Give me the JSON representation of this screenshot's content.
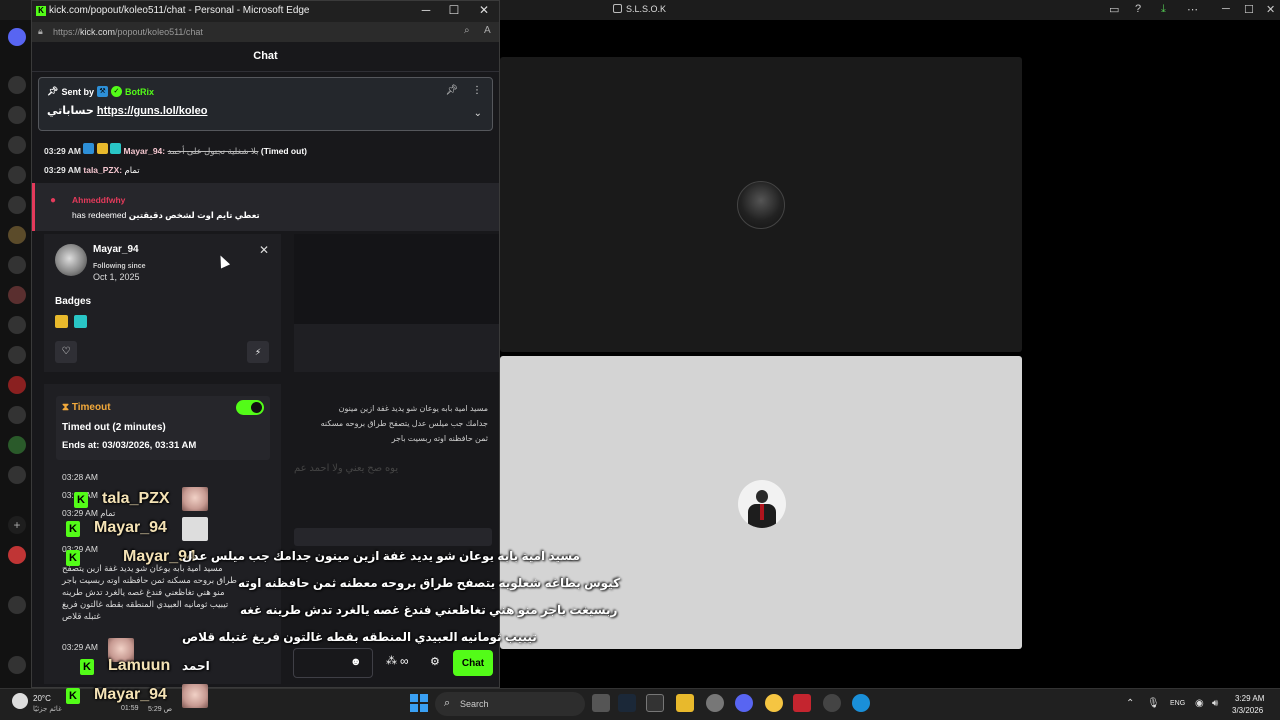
{
  "background_app": {
    "title": "S.L.S.O.K"
  },
  "edge": {
    "title": "kick.com/popout/koleo511/chat - Personal - Microsoft Edge",
    "url_prefix": "https://",
    "url_host": "kick.com",
    "url_path": "/popout/koleo511/chat",
    "minimize": "─",
    "maximize": "☐",
    "close": "✕"
  },
  "chat": {
    "header": "Chat",
    "pinned": {
      "sent_by": "Sent by",
      "sender": "BotRix",
      "text_prefix": "حساباتي",
      "link": "https://guns.lol/koleo"
    },
    "messages": [
      {
        "time": "03:29 AM",
        "user": "Mayar_94:",
        "text": "بلا شغلية نجنول على أحمد",
        "suffix": "(Timed out)"
      },
      {
        "time": "03:29 AM",
        "user": "tala_PZX:",
        "text": "تمام"
      }
    ],
    "redeem": {
      "user": "Ahmeddfwhy",
      "text_prefix": "has redeemed",
      "reward": "تعطي تايم اوت لشخص دقيقتين"
    },
    "side_arabic": "مسيد امية بابه يوعان شو يديد غفة ازين مينون جدامك جب ميلس عدل يتصفح طراق بروحه مسكنه ثمن حافظنه اوته ربسيت باجر",
    "faded": "يوه صح يعني ولا احمد عم",
    "send_label": "Chat"
  },
  "profile": {
    "name": "Mayar_94",
    "following_label": "Following since",
    "following_date": "Oct 1, 2025",
    "badges_label": "Badges"
  },
  "timeout": {
    "label": "Timeout",
    "title": "Timed out (2 minutes)",
    "ends": "Ends at: 03/03/2026, 03:31 AM",
    "history": [
      "03:28 AM",
      "03:29 AM",
      "03:29 AM تمام",
      "03:29 AM",
      "03:29 AM",
      "03:29 AM"
    ],
    "history_text": "مسيد امية بابه يوعان شو يديد غفة ازين يتصفح طراق بروحه مسكنه ثمن حافظنه اوته ربسيت باجر منو هني تغاظعني فندغ غصه يالغرد تدش طرينه تيبيب ثومانيه العبيدي المنطقه بقطه غالتون فريغ غتبله قلاص"
  },
  "overlay": {
    "names": [
      "tala_PZX",
      "Mayar_94",
      "Mayar_94",
      "Lamuun",
      "Mayar_94"
    ],
    "captions": [
      "مسيد امية بابه يوعان شو يديد غفة ازين مينون جدامك جب ميلس عدل",
      "كيوس بطاغه شغلويه يتصفح طراق بروحه معطنه ثمن حافظنه اوته",
      "ربسيغت باجر منو هني تغاظعني فندغ غصه يالغرد تدش طرينه غغه",
      "تيبيب ثومانيه العبيدي المنطقه بقطه غالتون فريغ غتبله قلاص"
    ],
    "lamuun_msg": "احمد"
  },
  "taskbar": {
    "weather_temp": "20°C",
    "weather_desc": "غائم جزئيًا",
    "time_a": "01:59",
    "time_b": "5:29 ص",
    "search": "Search",
    "lang": "ENG",
    "clock": "3:29 AM",
    "date": "3/3/2026"
  }
}
